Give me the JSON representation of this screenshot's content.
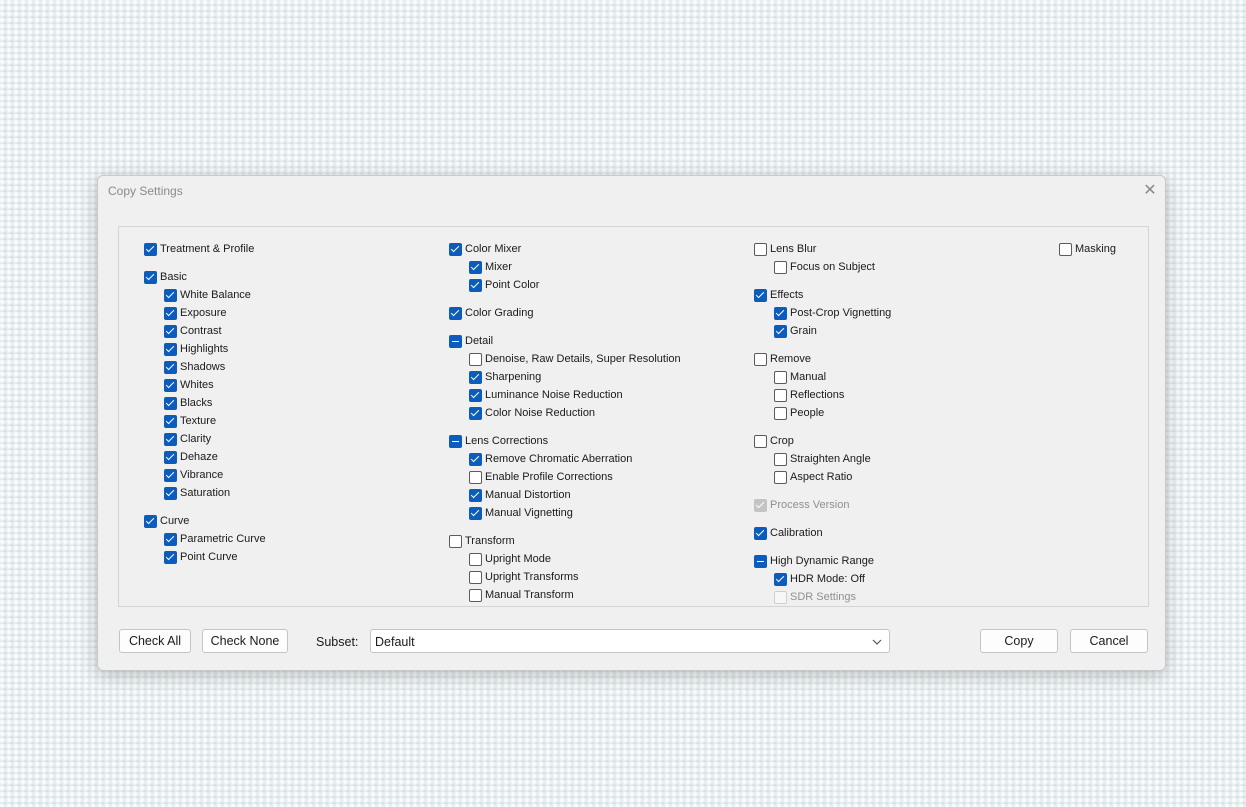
{
  "dialog": {
    "title": "Copy Settings",
    "close_glyph": "✕"
  },
  "columns": [
    [
      {
        "label": "Treatment & Profile",
        "state": "checked",
        "level": 0
      },
      {
        "gap": true
      },
      {
        "label": "Basic",
        "state": "checked",
        "level": 0
      },
      {
        "label": "White Balance",
        "state": "checked",
        "level": 1
      },
      {
        "label": "Exposure",
        "state": "checked",
        "level": 1
      },
      {
        "label": "Contrast",
        "state": "checked",
        "level": 1
      },
      {
        "label": "Highlights",
        "state": "checked",
        "level": 1
      },
      {
        "label": "Shadows",
        "state": "checked",
        "level": 1
      },
      {
        "label": "Whites",
        "state": "checked",
        "level": 1
      },
      {
        "label": "Blacks",
        "state": "checked",
        "level": 1
      },
      {
        "label": "Texture",
        "state": "checked",
        "level": 1
      },
      {
        "label": "Clarity",
        "state": "checked",
        "level": 1
      },
      {
        "label": "Dehaze",
        "state": "checked",
        "level": 1
      },
      {
        "label": "Vibrance",
        "state": "checked",
        "level": 1
      },
      {
        "label": "Saturation",
        "state": "checked",
        "level": 1
      },
      {
        "gap": true
      },
      {
        "label": "Curve",
        "state": "checked",
        "level": 0
      },
      {
        "label": "Parametric Curve",
        "state": "checked",
        "level": 1
      },
      {
        "label": "Point Curve",
        "state": "checked",
        "level": 1
      }
    ],
    [
      {
        "label": "Color Mixer",
        "state": "checked",
        "level": 0
      },
      {
        "label": "Mixer",
        "state": "checked",
        "level": 1
      },
      {
        "label": "Point Color",
        "state": "checked",
        "level": 1
      },
      {
        "gap": true
      },
      {
        "label": "Color Grading",
        "state": "checked",
        "level": 0
      },
      {
        "gap": true
      },
      {
        "label": "Detail",
        "state": "partial",
        "level": 0
      },
      {
        "label": "Denoise, Raw Details, Super Resolution",
        "state": "unchecked",
        "level": 1
      },
      {
        "label": "Sharpening",
        "state": "checked",
        "level": 1
      },
      {
        "label": "Luminance Noise Reduction",
        "state": "checked",
        "level": 1
      },
      {
        "label": "Color Noise Reduction",
        "state": "checked",
        "level": 1
      },
      {
        "gap": true
      },
      {
        "label": "Lens Corrections",
        "state": "partial",
        "level": 0
      },
      {
        "label": "Remove Chromatic Aberration",
        "state": "checked",
        "level": 1
      },
      {
        "label": "Enable Profile Corrections",
        "state": "unchecked",
        "level": 1
      },
      {
        "label": "Manual Distortion",
        "state": "checked",
        "level": 1
      },
      {
        "label": "Manual Vignetting",
        "state": "checked",
        "level": 1
      },
      {
        "gap": true
      },
      {
        "label": "Transform",
        "state": "unchecked",
        "level": 0
      },
      {
        "label": "Upright Mode",
        "state": "unchecked",
        "level": 1
      },
      {
        "label": "Upright Transforms",
        "state": "unchecked",
        "level": 1
      },
      {
        "label": "Manual Transform",
        "state": "unchecked",
        "level": 1
      }
    ],
    [
      {
        "label": "Lens Blur",
        "state": "unchecked",
        "level": 0
      },
      {
        "label": "Focus on Subject",
        "state": "unchecked",
        "level": 1
      },
      {
        "gap": true
      },
      {
        "label": "Effects",
        "state": "checked",
        "level": 0
      },
      {
        "label": "Post-Crop Vignetting",
        "state": "checked",
        "level": 1
      },
      {
        "label": "Grain",
        "state": "checked",
        "level": 1
      },
      {
        "gap": true
      },
      {
        "label": "Remove",
        "state": "unchecked",
        "level": 0
      },
      {
        "label": "Manual",
        "state": "unchecked",
        "level": 1
      },
      {
        "label": "Reflections",
        "state": "unchecked",
        "level": 1
      },
      {
        "label": "People",
        "state": "unchecked",
        "level": 1
      },
      {
        "gap": true
      },
      {
        "label": "Crop",
        "state": "unchecked",
        "level": 0
      },
      {
        "label": "Straighten Angle",
        "state": "unchecked",
        "level": 1
      },
      {
        "label": "Aspect Ratio",
        "state": "unchecked",
        "level": 1
      },
      {
        "gap": true
      },
      {
        "label": "Process Version",
        "state": "disabled-checked",
        "level": 0
      },
      {
        "gap": true
      },
      {
        "label": "Calibration",
        "state": "checked",
        "level": 0
      },
      {
        "gap": true
      },
      {
        "label": "High Dynamic Range",
        "state": "partial",
        "level": 0
      },
      {
        "label": "HDR Mode: Off",
        "state": "checked",
        "level": 1
      },
      {
        "label": "SDR Settings",
        "state": "disabled-unchecked",
        "level": 1
      }
    ],
    [
      {
        "label": "Masking",
        "state": "unchecked",
        "level": 0
      }
    ]
  ],
  "footer": {
    "check_all": "Check All",
    "check_none": "Check None",
    "subset_label": "Subset:",
    "subset_value": "Default",
    "copy": "Copy",
    "cancel": "Cancel"
  },
  "colors": {
    "accent": "#0b5cbc",
    "dialog_bg": "#f0f0f0"
  }
}
